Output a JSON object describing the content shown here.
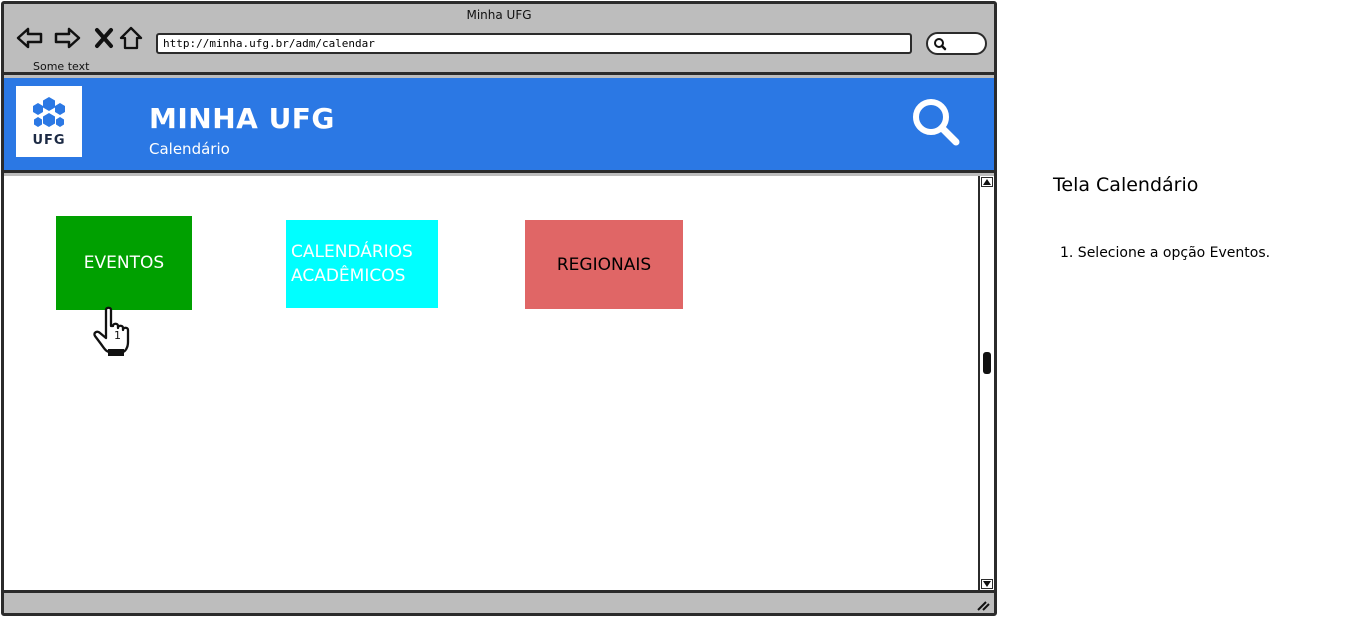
{
  "browser": {
    "window_title": "Minha UFG",
    "url": "http://minha.ufg.br/adm/calendar",
    "status_text": "Some text",
    "nav_icons": [
      "back-arrow-icon",
      "forward-arrow-icon",
      "close-x-icon",
      "home-icon"
    ]
  },
  "app": {
    "logo_text": "UFG",
    "title": "MINHA UFG",
    "subtitle": "Calendário",
    "header_color": "#2b78e4"
  },
  "tiles": [
    {
      "label": "EVENTOS",
      "color": "#00a000"
    },
    {
      "label": "CALENDÁRIOS ACADÊMICOS",
      "color": "#00ffff"
    },
    {
      "label": "REGIONAIS",
      "color": "#e06666"
    }
  ],
  "cursor": {
    "label": "1",
    "icon": "pointing-hand-icon"
  },
  "notes": {
    "title": "Tela Calendário",
    "steps": [
      "1. Selecione a opção Eventos."
    ]
  }
}
